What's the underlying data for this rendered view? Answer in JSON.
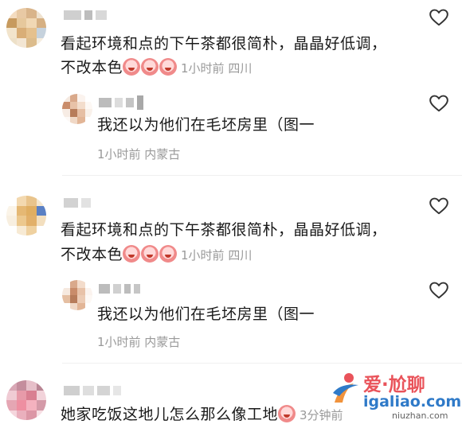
{
  "comments": [
    {
      "text_line1": "看起环境和点的下午茶都很简朴，晶晶好低调，",
      "text_line2": "不改本色",
      "emoji_count": 3,
      "meta": "1小时前 四川",
      "reply": {
        "text": "我还以为他们在毛坯房里（图一",
        "meta": "1小时前 内蒙古"
      }
    },
    {
      "text_line1": "看起环境和点的下午茶都很简朴，晶晶好低调，",
      "text_line2": "不改本色",
      "emoji_count": 3,
      "meta": "1小时前 四川",
      "reply": {
        "text": "我还以为他们在毛坯房里（图一",
        "meta": "1小时前 内蒙古"
      }
    },
    {
      "text_line1": "她家吃饭这地儿怎么那么像工地",
      "emoji_count": 1,
      "meta": "3分钟前"
    }
  ],
  "watermark": {
    "brand": "爱·尬聊",
    "url": "igaliao.com",
    "url2": "niuzhan.com"
  },
  "icons": {
    "like": "heart-outline-icon",
    "emoji": "crying-face-emoji"
  },
  "colors": {
    "text": "#1a1a1a",
    "meta": "#9a9a9a",
    "watermark_red": "#e8454d",
    "watermark_blue": "#1e6fc4"
  }
}
